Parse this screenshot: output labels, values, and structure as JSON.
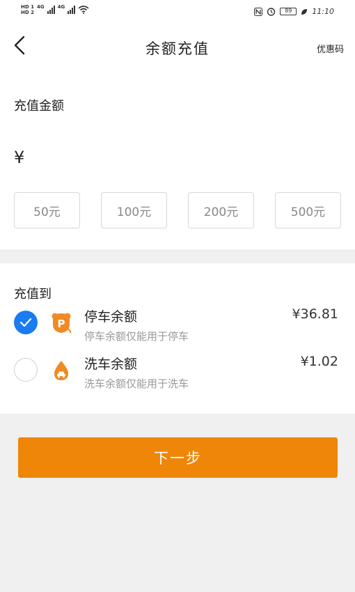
{
  "status_bar": {
    "hd1": "HD 1",
    "hd2": "HD 2",
    "net1": "4G",
    "net2": "4G",
    "battery": "89",
    "time": "11:10"
  },
  "nav": {
    "title": "余额充值",
    "coupon_label": "优惠码"
  },
  "amount": {
    "label": "充值金额",
    "currency_symbol": "¥",
    "input_value": "",
    "presets": [
      "50元",
      "100元",
      "200元",
      "500元"
    ]
  },
  "target": {
    "label": "充值到",
    "options": [
      {
        "title": "停车余额",
        "description": "停车余额仅能用于停车",
        "balance": "¥36.81",
        "checked": true,
        "icon": "parking-icon"
      },
      {
        "title": "洗车余额",
        "description": "洗车余额仅能用于洗车",
        "balance": "¥1.02",
        "checked": false,
        "icon": "car-wash-icon"
      }
    ]
  },
  "next_button": "下一步",
  "colors": {
    "accent": "#ef8608",
    "check_blue": "#1a7bf2",
    "icon_orange": "#f08a24"
  }
}
